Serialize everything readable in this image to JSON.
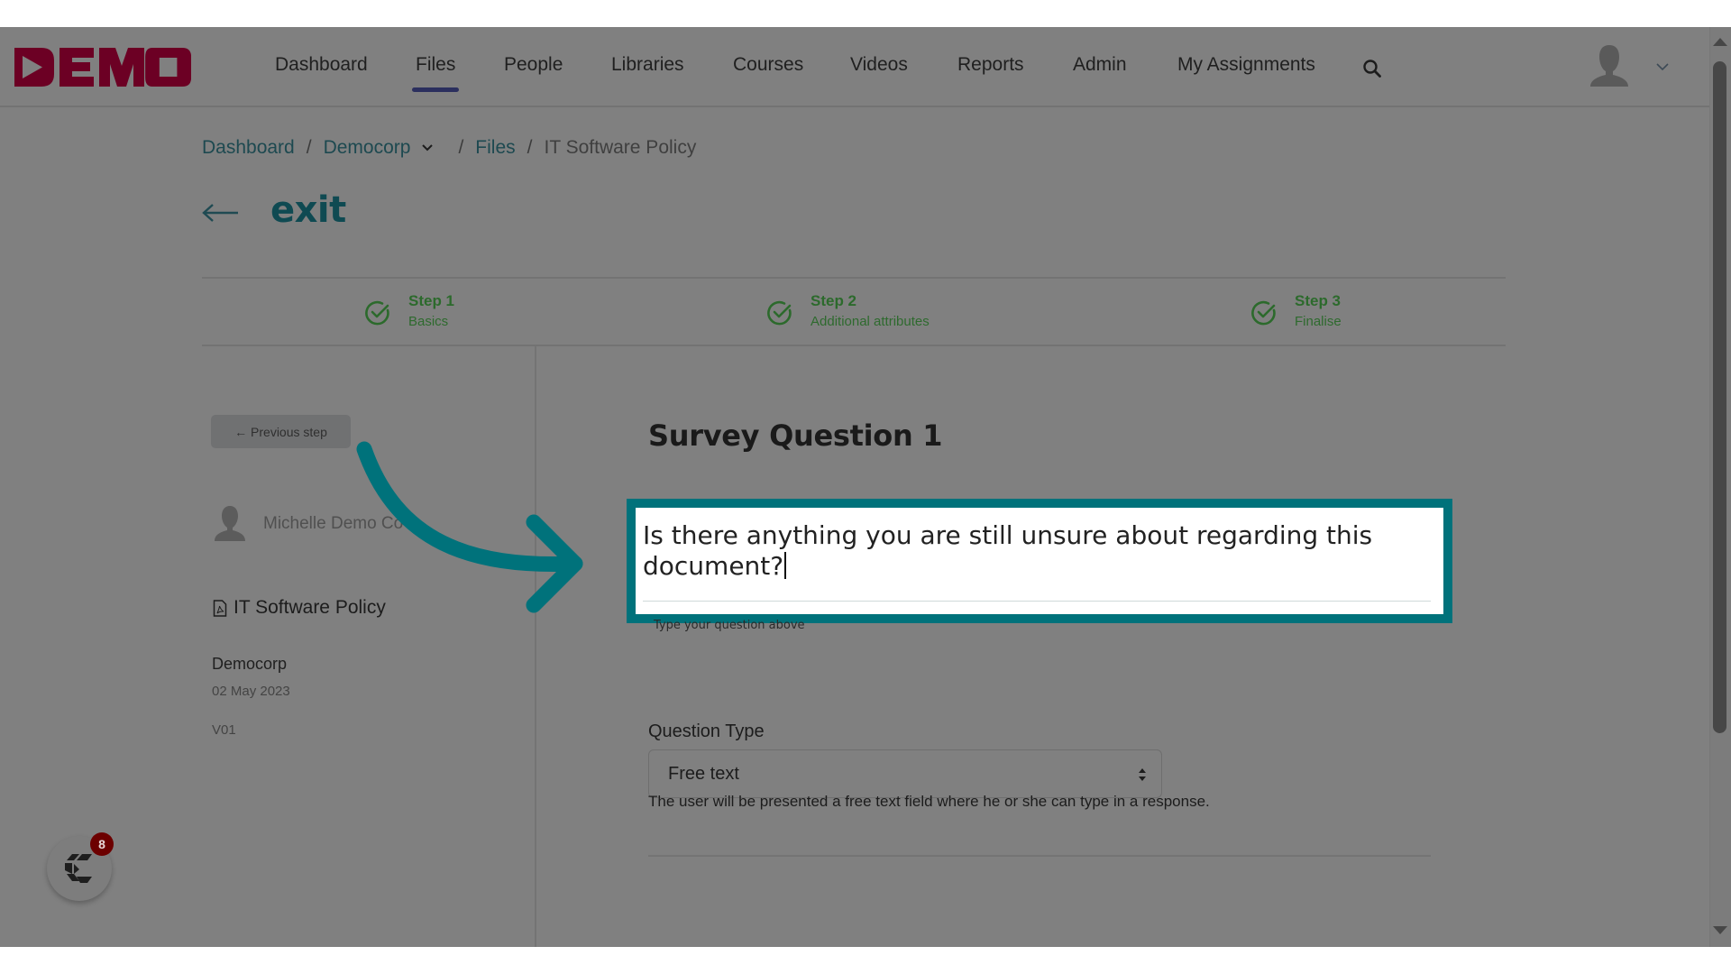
{
  "brand": {
    "logo_text": "DEMO",
    "logo_color": "#6c0024"
  },
  "nav": {
    "items": [
      {
        "label": "Dashboard",
        "active": false
      },
      {
        "label": "Files",
        "active": true
      },
      {
        "label": "People",
        "active": false
      },
      {
        "label": "Libraries",
        "active": false
      },
      {
        "label": "Courses",
        "active": false
      },
      {
        "label": "Videos",
        "active": false
      },
      {
        "label": "Reports",
        "active": false
      },
      {
        "label": "Admin",
        "active": false
      },
      {
        "label": "My Assignments",
        "active": false
      }
    ],
    "search_icon": "search-icon",
    "user_icon": "user-avatar-icon",
    "menu_icon": "chevron-down-icon"
  },
  "breadcrumb": [
    {
      "label": "Dashboard",
      "link": true
    },
    {
      "label": "Democorp",
      "link": true,
      "dropdown": true
    },
    {
      "label": "Files",
      "link": true
    },
    {
      "label": "IT Software Policy",
      "link": false
    }
  ],
  "page": {
    "back_icon": "arrow-left-icon",
    "title": "exit"
  },
  "steps": [
    {
      "label": "Step 1",
      "sub": "Basics",
      "complete": true
    },
    {
      "label": "Step 2",
      "sub": "Additional attributes",
      "complete": true
    },
    {
      "label": "Step 3",
      "sub": "Finalise",
      "complete": true
    }
  ],
  "sidebar": {
    "prev_button": "← Previous step",
    "author": "Michelle Demo Co",
    "document": "IT Software Policy",
    "organisation": "Democorp",
    "date": "02 May 2023",
    "version": "V01"
  },
  "form": {
    "heading": "Survey Question 1",
    "question_value": "Is there anything you are still unsure about regarding this document?",
    "question_help": "Type your question above",
    "question_type_label": "Question Type",
    "question_type_value": "Free text",
    "question_type_description": "The user will be presented a free text field where he or she can type in a response."
  },
  "chat": {
    "badge_count": "8"
  },
  "colors": {
    "accent_teal": "#00727b",
    "step_green": "#2c6a2c",
    "active_tab": "#2b2f5e",
    "badge": "#6c0000"
  }
}
